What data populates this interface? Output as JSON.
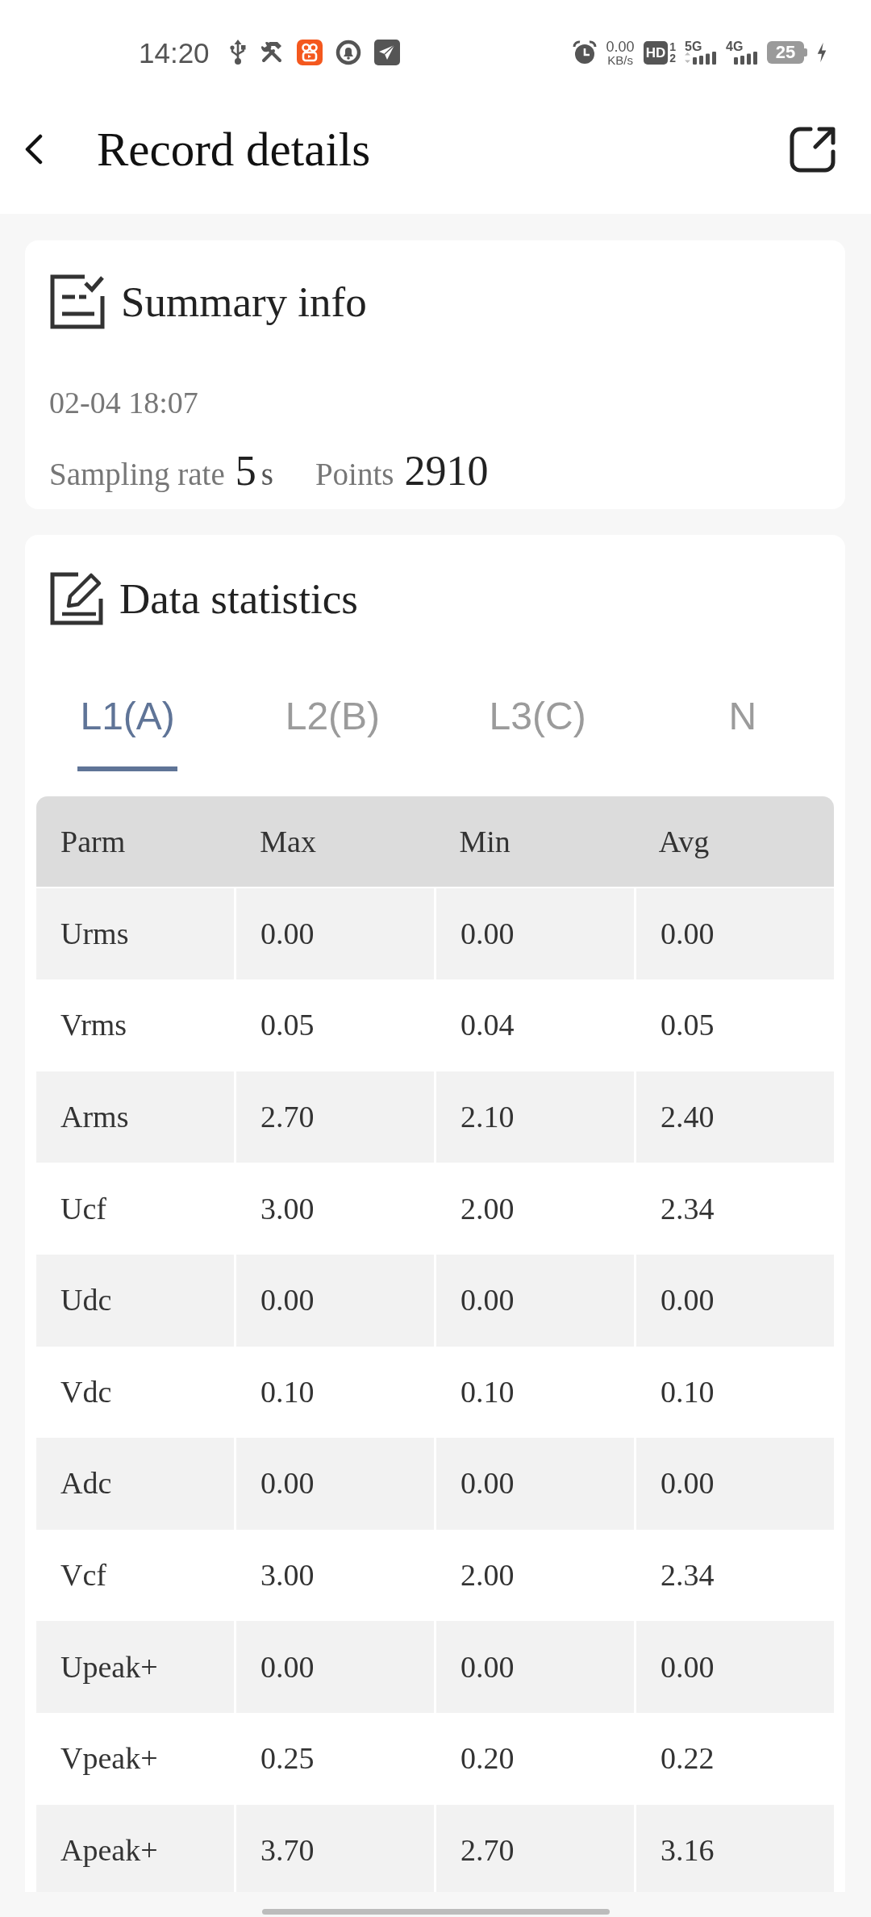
{
  "status_bar": {
    "time": "14:20",
    "net_speed": "0.00",
    "net_unit": "KB/s",
    "hd": "HD",
    "hd_slots": [
      "1",
      "2"
    ],
    "networks": [
      {
        "label": "5G",
        "data_active": true
      },
      {
        "label": "4G",
        "data_active": false
      }
    ],
    "battery": "25",
    "charging": true
  },
  "app_bar": {
    "title": "Record details"
  },
  "summary": {
    "title": "Summary info",
    "date": "02-04 18:07",
    "sampling_label": "Sampling rate",
    "sampling_value": "5",
    "sampling_unit": "s",
    "points_label": "Points",
    "points_value": "2910"
  },
  "statistics": {
    "title": "Data statistics",
    "tabs": [
      {
        "label": "L1(A)",
        "selected": true
      },
      {
        "label": "L2(B)",
        "selected": false
      },
      {
        "label": "L3(C)",
        "selected": false
      },
      {
        "label": "N",
        "selected": false
      }
    ],
    "table": {
      "columns": [
        "Parm",
        "Max",
        "Min",
        "Avg"
      ],
      "rows": [
        [
          "Urms",
          "0.00",
          "0.00",
          "0.00"
        ],
        [
          "Vrms",
          "0.05",
          "0.04",
          "0.05"
        ],
        [
          "Arms",
          "2.70",
          "2.10",
          "2.40"
        ],
        [
          "Ucf",
          "3.00",
          "2.00",
          "2.34"
        ],
        [
          "Udc",
          "0.00",
          "0.00",
          "0.00"
        ],
        [
          "Vdc",
          "0.10",
          "0.10",
          "0.10"
        ],
        [
          "Adc",
          "0.00",
          "0.00",
          "0.00"
        ],
        [
          "Vcf",
          "3.00",
          "2.00",
          "2.34"
        ],
        [
          "Upeak+",
          "0.00",
          "0.00",
          "0.00"
        ],
        [
          "Vpeak+",
          "0.25",
          "0.20",
          "0.22"
        ],
        [
          "Apeak+",
          "3.70",
          "2.70",
          "3.16"
        ]
      ]
    }
  }
}
